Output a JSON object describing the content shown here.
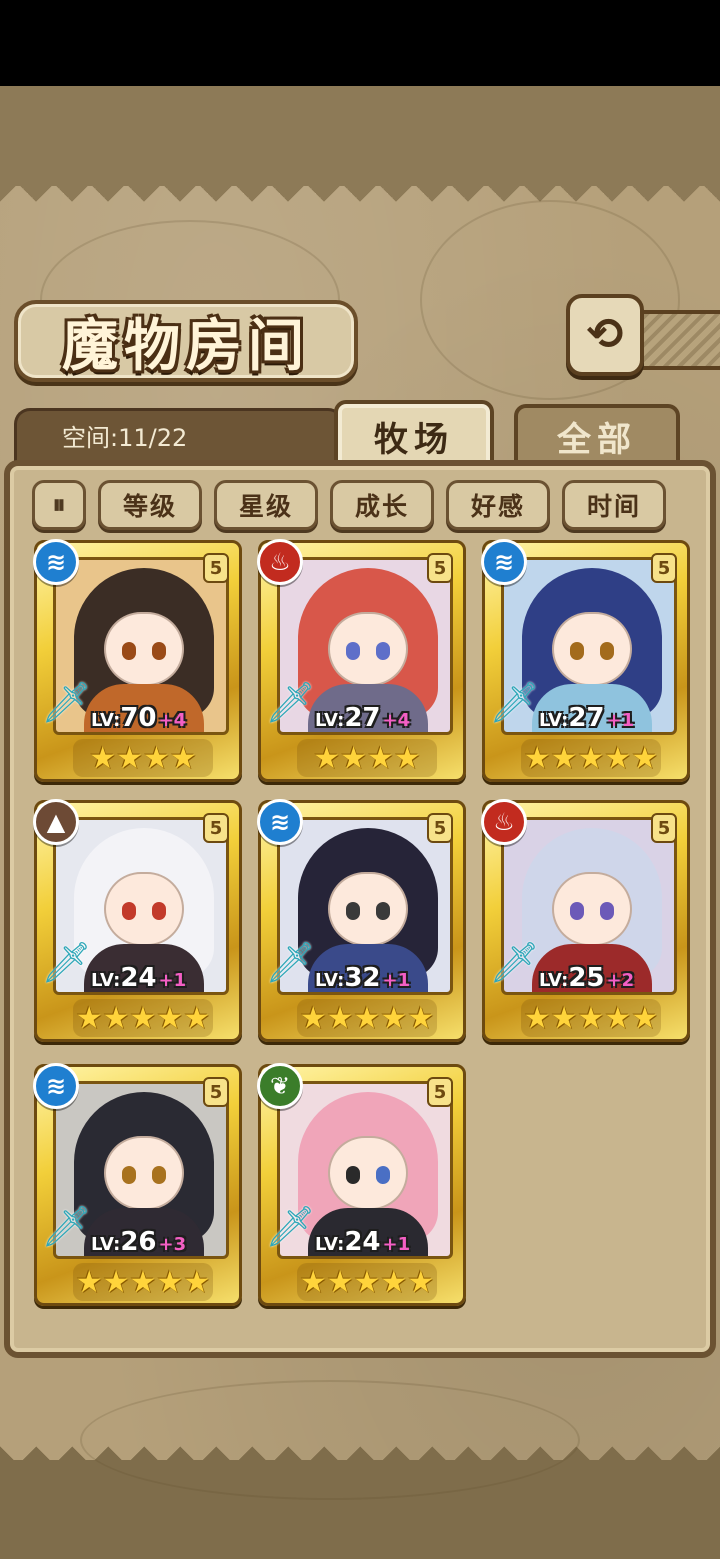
{
  "header": {
    "title": "魔物房间"
  },
  "space": {
    "label": "空间:11/22"
  },
  "tabs": [
    {
      "label": "牧场"
    },
    {
      "label": "全部"
    }
  ],
  "sort": [
    {
      "label": "等级"
    },
    {
      "label": "星级"
    },
    {
      "label": "成长"
    },
    {
      "label": "好感"
    },
    {
      "label": "时间"
    }
  ],
  "icons": {
    "back": "back-arrow-icon",
    "sort_toggle": "sort-order-icon",
    "sword": "sword-icon",
    "star": "star-icon"
  },
  "colors": {
    "water": "#1f7fd0",
    "fire": "#c22b1f",
    "earth": "#6d4a35",
    "wind": "#3b7d2a",
    "plus": "#f35fc4",
    "gold": "#f2cf3a"
  },
  "monsters": [
    {
      "element": "water",
      "level": "70",
      "bonus": "+4",
      "stars": "★★★★",
      "rank": "5"
    },
    {
      "element": "fire",
      "level": "27",
      "bonus": "+4",
      "stars": "★★★★",
      "rank": "5"
    },
    {
      "element": "water",
      "level": "27",
      "bonus": "+1",
      "stars": "★★★★★",
      "rank": "5"
    },
    {
      "element": "earth",
      "level": "24",
      "bonus": "+1",
      "stars": "★★★★★",
      "rank": "5"
    },
    {
      "element": "water",
      "level": "32",
      "bonus": "+1",
      "stars": "★★★★★",
      "rank": "5"
    },
    {
      "element": "fire",
      "level": "25",
      "bonus": "+2",
      "stars": "★★★★★",
      "rank": "5"
    },
    {
      "element": "water",
      "level": "26",
      "bonus": "+3",
      "stars": "★★★★★",
      "rank": "5"
    },
    {
      "element": "wind",
      "level": "24",
      "bonus": "+1",
      "stars": "★★★★★",
      "rank": "5"
    }
  ],
  "labels": {
    "lv": "LV:"
  }
}
